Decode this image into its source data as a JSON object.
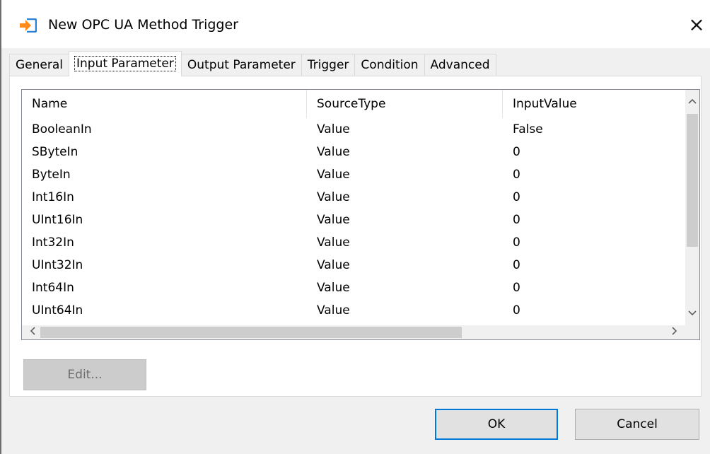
{
  "window": {
    "title": "New OPC UA Method Trigger",
    "close_glyph": "×",
    "app_icon": "arrow-into-box-icon",
    "accent_color": "#0078d7"
  },
  "tabs": [
    {
      "label": "General",
      "active": false
    },
    {
      "label": "Input Parameter",
      "active": true
    },
    {
      "label": "Output Parameter",
      "active": false
    },
    {
      "label": "Trigger",
      "active": false
    },
    {
      "label": "Condition",
      "active": false
    },
    {
      "label": "Advanced",
      "active": false
    }
  ],
  "parameters": {
    "columns": [
      "Name",
      "SourceType",
      "InputValue"
    ],
    "rows": [
      [
        "BooleanIn",
        "Value",
        "False"
      ],
      [
        "SByteIn",
        "Value",
        "0"
      ],
      [
        "ByteIn",
        "Value",
        "0"
      ],
      [
        "Int16In",
        "Value",
        "0"
      ],
      [
        "UInt16In",
        "Value",
        "0"
      ],
      [
        "Int32In",
        "Value",
        "0"
      ],
      [
        "UInt32In",
        "Value",
        "0"
      ],
      [
        "Int64In",
        "Value",
        "0"
      ],
      [
        "UInt64In",
        "Value",
        "0"
      ]
    ]
  },
  "scrollbars": {
    "up": "^",
    "down": "v",
    "left": "<",
    "right": ">"
  },
  "buttons": {
    "edit": "Edit...",
    "edit_enabled": false,
    "ok": "OK",
    "cancel": "Cancel"
  }
}
